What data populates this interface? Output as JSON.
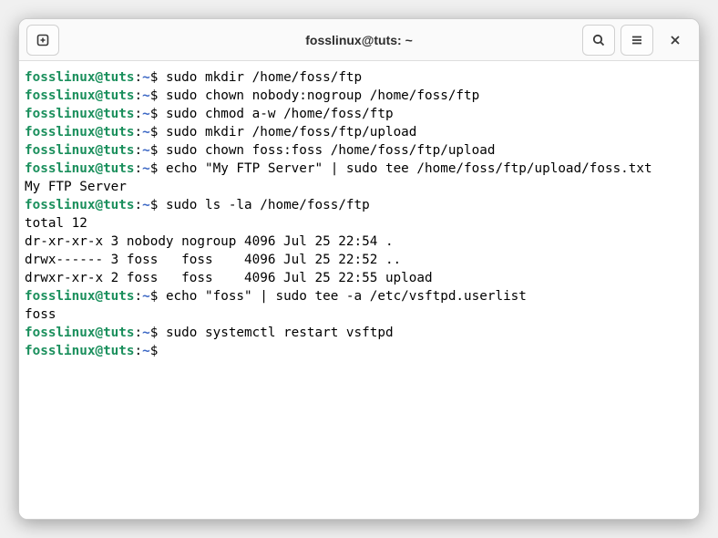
{
  "window": {
    "title": "fosslinux@tuts: ~"
  },
  "prompt": {
    "user_host": "fosslinux@tuts",
    "path": "~",
    "symbol": "$"
  },
  "lines": [
    {
      "type": "cmd",
      "text": "sudo mkdir /home/foss/ftp"
    },
    {
      "type": "cmd",
      "text": "sudo chown nobody:nogroup /home/foss/ftp"
    },
    {
      "type": "cmd",
      "text": "sudo chmod a-w /home/foss/ftp"
    },
    {
      "type": "cmd",
      "text": "sudo mkdir /home/foss/ftp/upload"
    },
    {
      "type": "cmd",
      "text": "sudo chown foss:foss /home/foss/ftp/upload"
    },
    {
      "type": "cmd",
      "text": "echo \"My FTP Server\" | sudo tee /home/foss/ftp/upload/foss.txt"
    },
    {
      "type": "out",
      "text": "My FTP Server"
    },
    {
      "type": "cmd",
      "text": "sudo ls -la /home/foss/ftp"
    },
    {
      "type": "out",
      "text": "total 12"
    },
    {
      "type": "out",
      "text": "dr-xr-xr-x 3 nobody nogroup 4096 Jul 25 22:54 ."
    },
    {
      "type": "out",
      "text": "drwx------ 3 foss   foss    4096 Jul 25 22:52 .."
    },
    {
      "type": "out",
      "text": "drwxr-xr-x 2 foss   foss    4096 Jul 25 22:55 upload"
    },
    {
      "type": "cmd",
      "text": "echo \"foss\" | sudo tee -a /etc/vsftpd.userlist"
    },
    {
      "type": "out",
      "text": "foss"
    },
    {
      "type": "cmd",
      "text": "sudo systemctl restart vsftpd"
    },
    {
      "type": "cmd",
      "text": ""
    }
  ],
  "icons": {
    "new_tab": "new-tab-icon",
    "search": "search-icon",
    "menu": "hamburger-icon",
    "close": "close-icon"
  }
}
